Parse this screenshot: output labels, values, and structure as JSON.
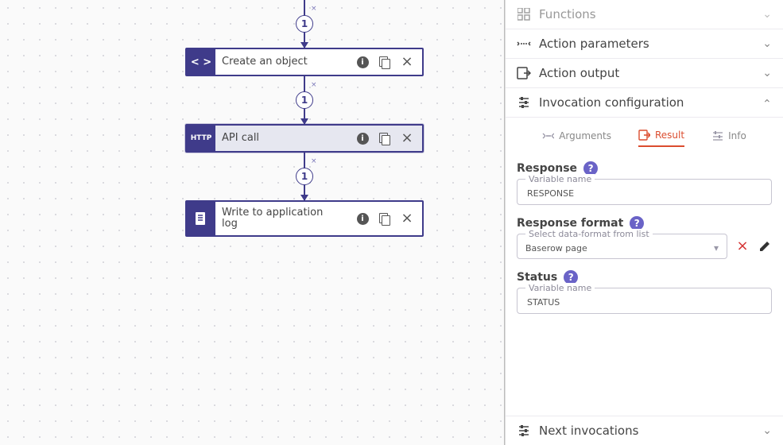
{
  "flow": {
    "nodes": {
      "partial": {
        "label": ""
      },
      "create": {
        "label": "Create an object",
        "icon": "code-icon"
      },
      "api": {
        "label": "API call",
        "icon": "http-icon",
        "icon_text": "HTTP"
      },
      "log": {
        "label": "Write to application log",
        "icon": "doc-icon"
      }
    },
    "connector_badge": "1",
    "connector_close": "×"
  },
  "panel": {
    "sections": {
      "functions": "Functions",
      "params": "Action parameters",
      "output": "Action output",
      "invoc": "Invocation configuration",
      "next": "Next invocations"
    },
    "tabs": {
      "arguments": "Arguments",
      "result": "Result",
      "info": "Info"
    },
    "groups": {
      "response": {
        "title": "Response",
        "fieldlabel": "Variable name",
        "value": "RESPONSE"
      },
      "format": {
        "title": "Response format",
        "fieldlabel": "Select data-format from list",
        "value": "Baserow page"
      },
      "status": {
        "title": "Status",
        "fieldlabel": "Variable name",
        "value": "STATUS"
      }
    }
  }
}
